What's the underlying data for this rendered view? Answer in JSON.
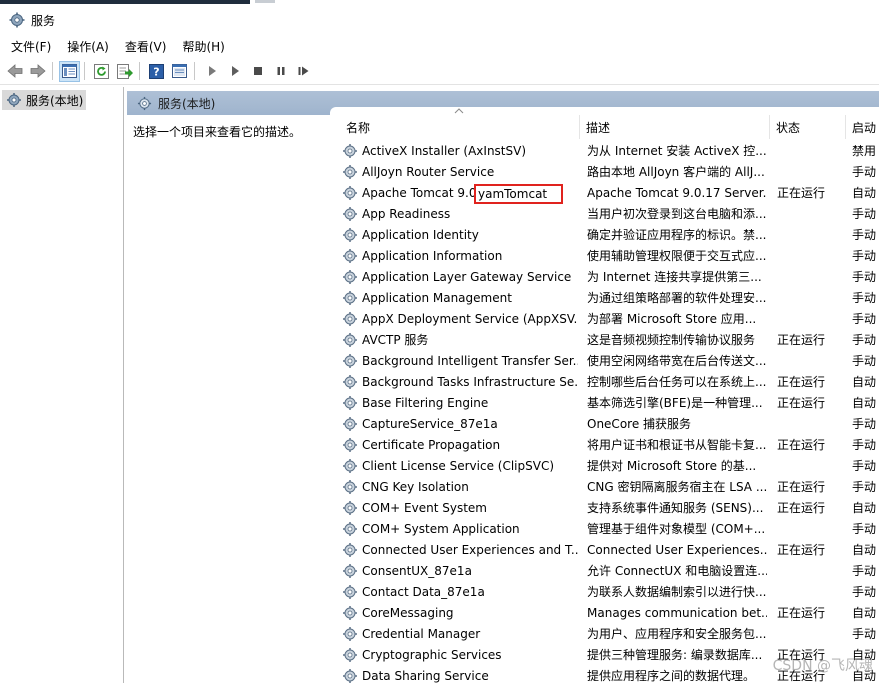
{
  "window": {
    "title": "服务"
  },
  "menu": [
    "文件(F)",
    "操作(A)",
    "查看(V)",
    "帮助(H)"
  ],
  "toolbar": {
    "buttons": [
      "back-icon",
      "forward-icon",
      "show-hide-tree-icon",
      "refresh-icon",
      "export-list-icon",
      "help-icon",
      "properties-icon",
      "start-service-icon",
      "start-alt-icon",
      "stop-service-icon",
      "pause-service-icon",
      "resume-service-icon"
    ]
  },
  "tree": {
    "root_label": "服务(本地)"
  },
  "panel": {
    "header": "服务(本地)",
    "description_hint": "选择一个项目来查看它的描述。"
  },
  "columns": {
    "name": "名称",
    "description": "描述",
    "status": "状态",
    "startup": "启动"
  },
  "services": [
    {
      "name": "ActiveX Installer (AxInstSV)",
      "description": "为从 Internet 安装 ActiveX 控...",
      "status": "",
      "startup": "禁用"
    },
    {
      "name": "AllJoyn Router Service",
      "description": "路由本地 AllJoyn 客户端的 AllJ...",
      "status": "",
      "startup": "手动"
    },
    {
      "name": "Apache Tomcat 9.0",
      "description": "Apache Tomcat 9.0.17 Server...",
      "status": "正在运行",
      "startup": "自动"
    },
    {
      "name": "App Readiness",
      "description": "当用户初次登录到这台电脑和添...",
      "status": "",
      "startup": "手动"
    },
    {
      "name": "Application Identity",
      "description": "确定并验证应用程序的标识。禁...",
      "status": "",
      "startup": "手动"
    },
    {
      "name": "Application Information",
      "description": "使用辅助管理权限便于交互式应...",
      "status": "",
      "startup": "手动"
    },
    {
      "name": "Application Layer Gateway Service",
      "description": "为 Internet 连接共享提供第三...",
      "status": "",
      "startup": "手动"
    },
    {
      "name": "Application Management",
      "description": "为通过组策略部署的软件处理安...",
      "status": "",
      "startup": "手动"
    },
    {
      "name": "AppX Deployment Service (AppXSV...",
      "description": "为部署 Microsoft Store 应用...",
      "status": "",
      "startup": "手动"
    },
    {
      "name": "AVCTP 服务",
      "description": "这是音频视频控制传输协议服务",
      "status": "正在运行",
      "startup": "手动"
    },
    {
      "name": "Background Intelligent Transfer Ser...",
      "description": "使用空闲网络带宽在后台传送文...",
      "status": "",
      "startup": "手动"
    },
    {
      "name": "Background Tasks Infrastructure Se...",
      "description": "控制哪些后台任务可以在系统上...",
      "status": "正在运行",
      "startup": "自动"
    },
    {
      "name": "Base Filtering Engine",
      "description": "基本筛选引擎(BFE)是一种管理...",
      "status": "正在运行",
      "startup": "自动"
    },
    {
      "name": "CaptureService_87e1a",
      "description": "OneCore 捕获服务",
      "status": "",
      "startup": "手动"
    },
    {
      "name": "Certificate Propagation",
      "description": "将用户证书和根证书从智能卡复...",
      "status": "正在运行",
      "startup": "手动"
    },
    {
      "name": "Client License Service (ClipSVC)",
      "description": "提供对 Microsoft Store 的基...",
      "status": "",
      "startup": "手动"
    },
    {
      "name": "CNG Key Isolation",
      "description": "CNG 密钥隔离服务宿主在 LSA ...",
      "status": "正在运行",
      "startup": "手动"
    },
    {
      "name": "COM+ Event System",
      "description": "支持系统事件通知服务 (SENS)...",
      "status": "正在运行",
      "startup": "自动"
    },
    {
      "name": "COM+ System Application",
      "description": "管理基于组件对象模型 (COM+...",
      "status": "",
      "startup": "手动"
    },
    {
      "name": "Connected User Experiences and T...",
      "description": "Connected User Experiences...",
      "status": "正在运行",
      "startup": "自动"
    },
    {
      "name": "ConsentUX_87e1a",
      "description": "允许 ConnectUX 和电脑设置连...",
      "status": "",
      "startup": "手动"
    },
    {
      "name": "Contact Data_87e1a",
      "description": "为联系人数据编制索引以进行快...",
      "status": "",
      "startup": "手动"
    },
    {
      "name": "CoreMessaging",
      "description": "Manages communication bet...",
      "status": "正在运行",
      "startup": "自动"
    },
    {
      "name": "Credential Manager",
      "description": "为用户、应用程序和安全服务包...",
      "status": "",
      "startup": "手动"
    },
    {
      "name": "Cryptographic Services",
      "description": "提供三种管理服务: 编录数据库...",
      "status": "正在运行",
      "startup": "自动"
    },
    {
      "name": "Data Sharing Service",
      "description": "提供应用程序之间的数据代理。",
      "status": "正在运行",
      "startup": "自动"
    }
  ],
  "annotation": {
    "text": "yamTomcat"
  },
  "watermark": "CSDN @飞风魂"
}
